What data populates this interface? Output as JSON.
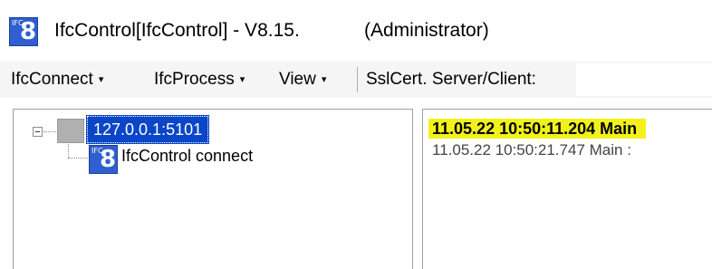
{
  "window": {
    "title": "IfcControl[IfcControl] - V8.15.",
    "role": "(Administrator)",
    "icon": "app-logo-icon"
  },
  "menu": {
    "items": [
      {
        "label": "IfcConnect",
        "caret": "▾"
      },
      {
        "label": "IfcProcess",
        "caret": "▾"
      },
      {
        "label": "View",
        "caret": "▾"
      }
    ],
    "sslcert_label": "SslCert. Server/Client:",
    "sslcert_value": ""
  },
  "tree": {
    "root": {
      "label": "127.0.0.1:5101",
      "selected": true,
      "icon": "server-node-icon"
    },
    "children": [
      {
        "label": "IfcControl connect",
        "icon": "app-logo-icon"
      }
    ]
  },
  "log": {
    "lines": [
      {
        "text": "11.05.22 10:50:11.204 Main",
        "highlighted": true,
        "color": "#f2f21a"
      },
      {
        "text": "11.05.22 10:50:21.747 Main     :",
        "highlighted": false
      }
    ]
  },
  "colors": {
    "selection": "#0a46c7",
    "highlight": "#f2f21a",
    "icon_blue": "#2f5fd0",
    "menubar_bg": "#f5f5f5"
  }
}
